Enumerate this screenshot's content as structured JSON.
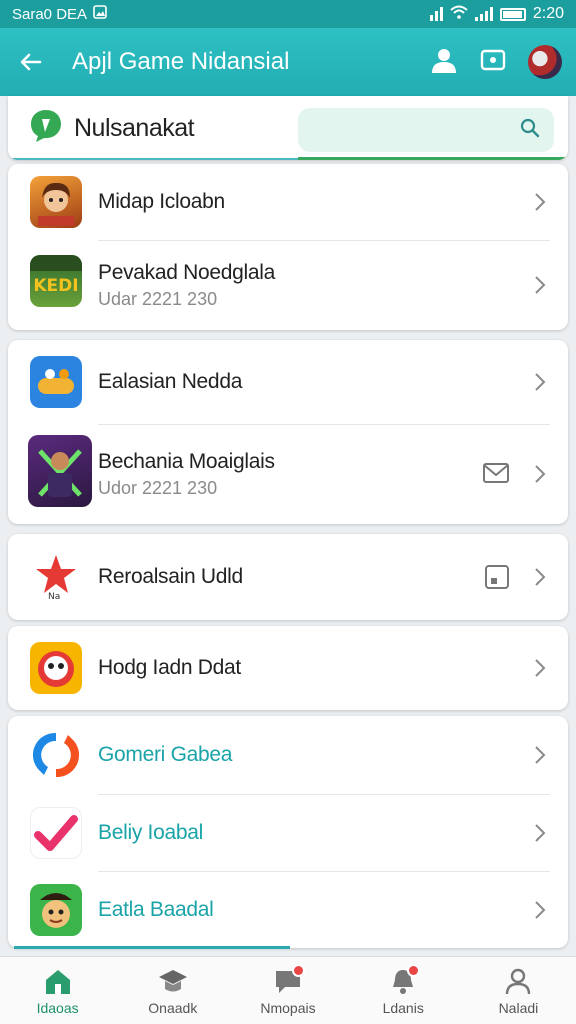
{
  "status": {
    "left_text": "Sara0 DEA",
    "time": "2:20"
  },
  "appbar": {
    "title": "Apjl Game Nidansial"
  },
  "search": {
    "brand": "Nulsanakat"
  },
  "list": [
    {
      "name": "Midap Icloabn",
      "sub": "",
      "icon": "avatar-game-icon",
      "teal": false
    },
    {
      "name": "Pevakad Noedglala",
      "sub": "Udar 2221 230",
      "icon": "kedi-game-icon",
      "teal": false
    },
    {
      "name": "Ealasian Nedda",
      "sub": "",
      "icon": "blue-game-icon",
      "teal": false
    },
    {
      "name": "Bechania Moaiglais",
      "sub": "Udor 2221 230",
      "icon": "warrior-game-icon",
      "teal": false,
      "extra": "mail-icon"
    },
    {
      "name": "Reroalsain Udld",
      "sub": "",
      "icon": "star-logo-icon",
      "teal": false,
      "extra": "square-icon"
    },
    {
      "name": "Hodg Iadn Ddat",
      "sub": "",
      "icon": "face-game-icon",
      "teal": false
    },
    {
      "name": "Gomeri Gabea",
      "sub": "",
      "icon": "swirl-logo-icon",
      "teal": true
    },
    {
      "name": "Beliy Ioabal",
      "sub": "",
      "icon": "check-icon",
      "teal": true
    },
    {
      "name": "Eatla Baadal",
      "sub": "",
      "icon": "character-game-icon",
      "teal": true
    }
  ],
  "nav": [
    {
      "label": "Idaoas",
      "icon": "home-icon",
      "active": true
    },
    {
      "label": "Onaadk",
      "icon": "graduation-cap-icon",
      "active": false
    },
    {
      "label": "Nmopais",
      "icon": "chat-icon",
      "active": false,
      "badge": true
    },
    {
      "label": "Ldanis",
      "icon": "notification-icon",
      "active": false,
      "badge": true
    },
    {
      "label": "Naladi",
      "icon": "profile-icon",
      "active": false
    }
  ],
  "colors": {
    "accent": "#22adb3",
    "teal_text": "#1aa4a8",
    "nav_active": "#1f8f6e"
  }
}
